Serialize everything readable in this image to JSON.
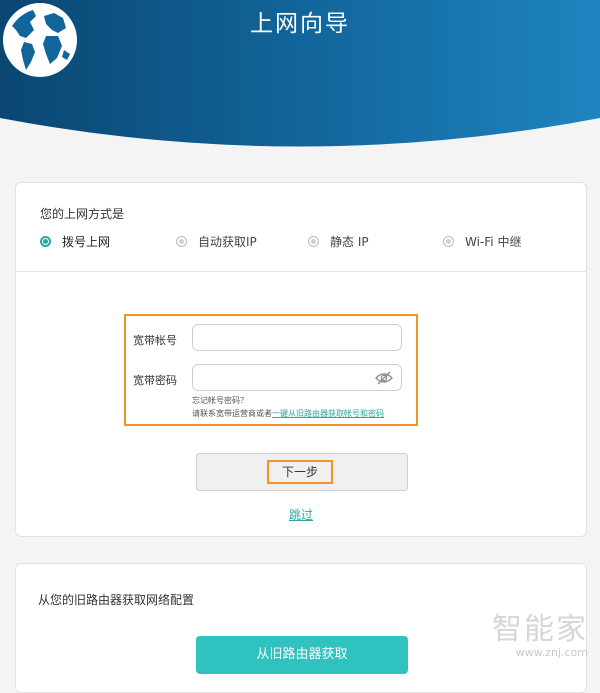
{
  "header": {
    "title": "上网向导"
  },
  "connection": {
    "label": "您的上网方式是",
    "options": [
      "拨号上网",
      "自动获取IP",
      "静态 IP",
      "Wi-Fi 中继"
    ],
    "selected": "拨号上网"
  },
  "form": {
    "account_label": "宽带帐号",
    "account_value": "",
    "password_label": "宽带密码",
    "password_value": "",
    "forgot_text": "忘记帐号密码？",
    "contact_text": "请联系宽带运营商或者",
    "import_link": "一键从旧路由器获取帐号和密码"
  },
  "actions": {
    "next_label": "下一步",
    "skip_label": "跳过"
  },
  "old_router": {
    "title": "从您的旧路由器获取网络配置",
    "button_label": "从旧路由器获取"
  },
  "watermark": {
    "brand": "智能家",
    "url": "www.znj.com"
  },
  "colors": {
    "accent": "#2aa6a6",
    "button": "#2fc2bf",
    "highlight": "#f0932b",
    "header_dark": "#0b4f7a",
    "header_light": "#1f7fba"
  }
}
